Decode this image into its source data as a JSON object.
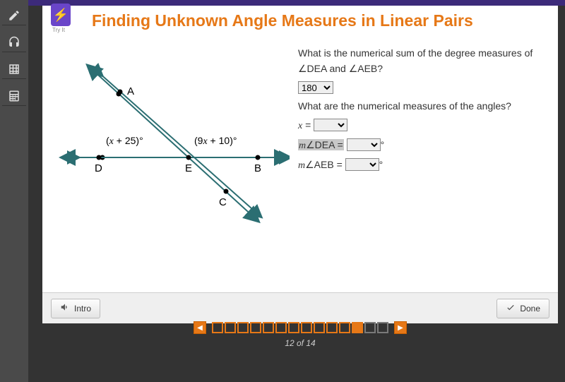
{
  "header": {
    "tryit_label": "Try It",
    "title": "Finding Unknown Angle Measures in Linear Pairs"
  },
  "diagram": {
    "points": {
      "A": "A",
      "B": "B",
      "C": "C",
      "D": "D",
      "E": "E"
    },
    "angle1_expr": "(x + 25)°",
    "angle2_expr": "(9x + 10)°"
  },
  "question": {
    "q1": "What is the numerical sum of the degree measures of ∠DEA and ∠AEB?",
    "sum_value": "180",
    "q2": "What are the numerical measures of the angles?",
    "x_label": "x =",
    "dea_label_m": "m",
    "dea_label_rest": "∠DEA =",
    "aeb_label_m": "m",
    "aeb_label_rest": "∠AEB =",
    "deg": "°"
  },
  "buttons": {
    "intro": "Intro",
    "done": "Done"
  },
  "footer": {
    "page_current": 12,
    "page_total": 14,
    "page_text": "12 of 14"
  }
}
